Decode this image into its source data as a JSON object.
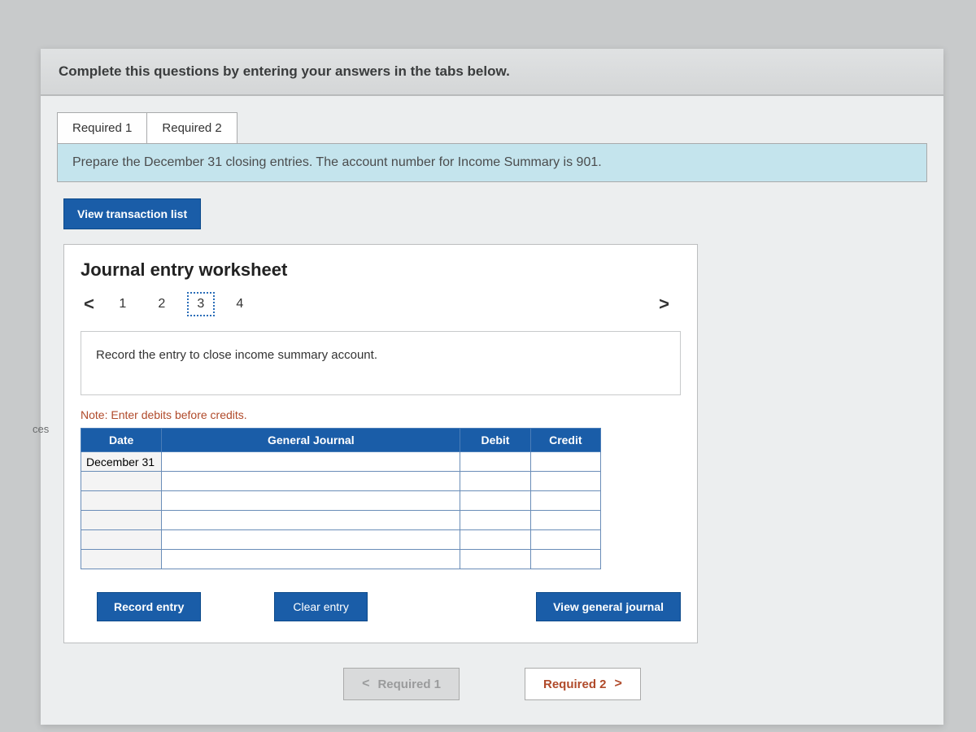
{
  "instruction": "Complete this questions by entering your answers in the tabs below.",
  "tabs": {
    "req1": "Required 1",
    "req2": "Required 2"
  },
  "sub_instruction": "Prepare the December 31 closing entries. The account number for Income Summary is 901.",
  "view_transaction_list": "View transaction list",
  "worksheet_title": "Journal entry worksheet",
  "side_label": "ces",
  "steps": {
    "prev": "<",
    "s1": "1",
    "s2": "2",
    "s3": "3",
    "s4": "4",
    "next": ">"
  },
  "current_step": 3,
  "entry_description": "Record the entry to close income summary account.",
  "note": "Note: Enter debits before credits.",
  "table": {
    "headers": {
      "date": "Date",
      "gj": "General Journal",
      "debit": "Debit",
      "credit": "Credit"
    },
    "rows": [
      {
        "date": "December 31",
        "gj": "",
        "debit": "",
        "credit": ""
      },
      {
        "date": "",
        "gj": "",
        "debit": "",
        "credit": ""
      },
      {
        "date": "",
        "gj": "",
        "debit": "",
        "credit": ""
      },
      {
        "date": "",
        "gj": "",
        "debit": "",
        "credit": ""
      },
      {
        "date": "",
        "gj": "",
        "debit": "",
        "credit": ""
      },
      {
        "date": "",
        "gj": "",
        "debit": "",
        "credit": ""
      }
    ]
  },
  "buttons": {
    "record": "Record entry",
    "clear": "Clear entry",
    "view_gj": "View general journal"
  },
  "footer": {
    "prev_label": "Required 1",
    "next_label": "Required 2",
    "chev_left": "<",
    "chev_right": ">"
  }
}
